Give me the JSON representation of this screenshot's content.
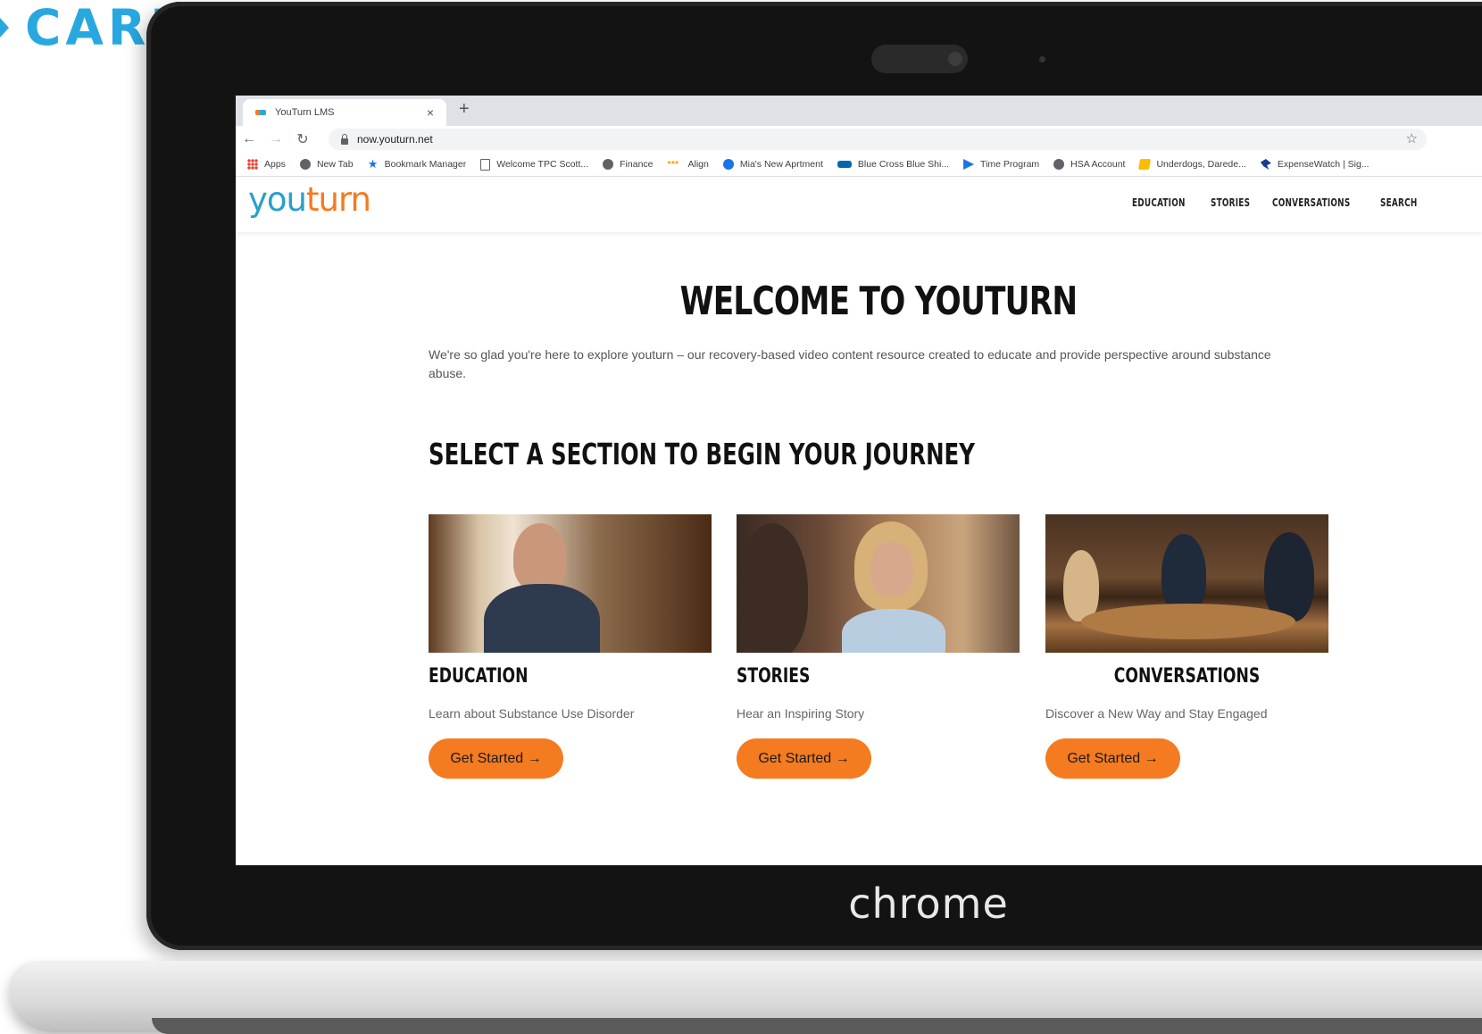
{
  "brand": {
    "text": "CARES",
    "color": "#29a8e0"
  },
  "laptop": {
    "bezel_logo": "chrome"
  },
  "browser": {
    "tab": {
      "title": "YouTurn LMS",
      "close_icon": "close-icon"
    },
    "new_tab_symbol": "+",
    "url": "now.youturn.net",
    "bookmarks": [
      {
        "label": "Apps",
        "icon": "apps-icon"
      },
      {
        "label": "New Tab",
        "icon": "globe-icon"
      },
      {
        "label": "Bookmark Manager",
        "icon": "star-icon"
      },
      {
        "label": "Welcome TPC Scott...",
        "icon": "document-icon"
      },
      {
        "label": "Finance",
        "icon": "globe-icon"
      },
      {
        "label": "Align",
        "icon": "dots-icon"
      },
      {
        "label": "Mia's New Aprtment",
        "icon": "circle-icon"
      },
      {
        "label": "Blue Cross Blue Shi...",
        "icon": "bcbs-icon"
      },
      {
        "label": "Time Program",
        "icon": "flag-icon"
      },
      {
        "label": "HSA Account",
        "icon": "globe-icon"
      },
      {
        "label": "Underdogs, Darede...",
        "icon": "note-icon"
      },
      {
        "label": "ExpenseWatch | Sig...",
        "icon": "bird-icon"
      }
    ]
  },
  "site": {
    "logo_you": "you",
    "logo_turn": "turn",
    "nav": [
      "EDUCATION",
      "STORIES",
      "CONVERSATIONS",
      "SEARCH"
    ],
    "welcome_title": "WELCOME TO YOUTURN",
    "intro": "We're so glad you're here to explore youturn – our recovery-based video content resource created to educate and provide perspective around substance abuse.",
    "select_title": "SELECT A SECTION TO BEGIN YOUR JOURNEY",
    "cards": [
      {
        "title": "EDUCATION",
        "description": "Learn about Substance Use Disorder",
        "button": "Get Started →"
      },
      {
        "title": "STORIES",
        "description": "Hear an Inspiring Story",
        "button": "Get Started →"
      },
      {
        "title": "CONVERSATIONS",
        "description": "Discover a New Way and Stay Engaged",
        "button": "Get Started →"
      }
    ],
    "colors": {
      "accent_orange": "#f47b20",
      "logo_blue": "#29a0c8"
    }
  }
}
